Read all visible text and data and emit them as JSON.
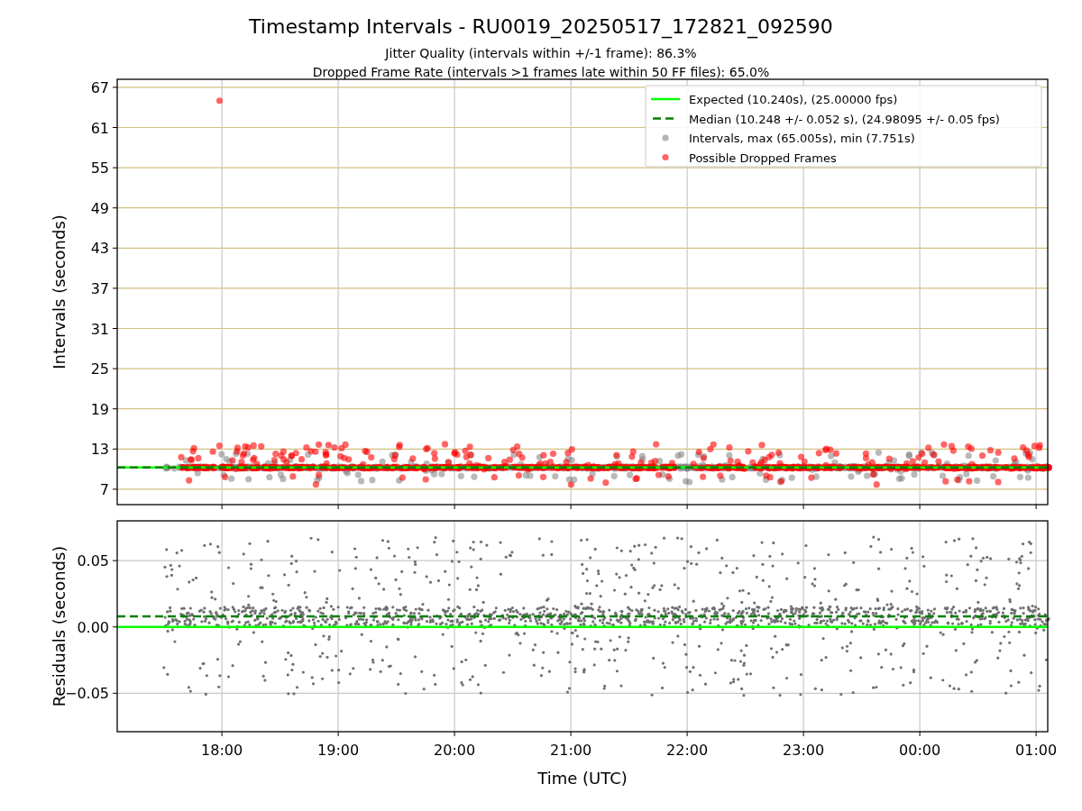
{
  "figure": {
    "title": "Timestamp Intervals - RU0019_20250517_172821_092590",
    "subtitles": [
      "Jitter Quality (intervals within +/-1 frame): 86.3%",
      "Dropped Frame Rate (intervals >1 frames late within 50 FF files): 65.0%"
    ]
  },
  "intervals_plot": {
    "chart_data": {
      "type": "scatter",
      "ylabel": "Intervals (seconds)",
      "ylim": [
        4.7,
        68.2
      ],
      "grid": true,
      "legend": true,
      "yticks": [
        {
          "value": 7,
          "label": "7"
        },
        {
          "value": 13,
          "label": "13"
        },
        {
          "value": 19,
          "label": "19"
        },
        {
          "value": 25,
          "label": "25"
        },
        {
          "value": 31,
          "label": "31"
        },
        {
          "value": 37,
          "label": "37"
        },
        {
          "value": 43,
          "label": "43"
        },
        {
          "value": 49,
          "label": "49"
        },
        {
          "value": 55,
          "label": "55"
        },
        {
          "value": 61,
          "label": "61"
        },
        {
          "value": 67,
          "label": "67"
        }
      ],
      "ref_lines": [
        {
          "axis": "y",
          "value": 10.24,
          "label": "Expected (10.240s), (25.00000 fps)",
          "color": "#00ff00"
        },
        {
          "axis": "y",
          "value": 10.248,
          "label": "Median (10.248 +/- 0.052 s), (24.98095 +/- 0.05 fps)",
          "color": "#008000"
        }
      ],
      "series": [
        {
          "name": "Intervals, max (65.005s), min (7.751s)",
          "color": "#808080"
        },
        {
          "name": "Possible Dropped Frames",
          "color": "#ff0000"
        }
      ]
    }
  },
  "residuals_plot": {
    "chart_data": {
      "type": "scatter",
      "xlabel": "Time (UTC)",
      "ylabel": "Residuals (seconds)",
      "xlim": [
        "2025-05-17T17:06",
        "2025-05-18T01:06"
      ],
      "ylim": [
        -0.079,
        0.08
      ],
      "grid": true,
      "xticks": [
        {
          "value": "2025-05-17T18:00",
          "label": "18:00"
        },
        {
          "value": "2025-05-17T19:00",
          "label": "19:00"
        },
        {
          "value": "2025-05-17T20:00",
          "label": "20:00"
        },
        {
          "value": "2025-05-17T21:00",
          "label": "21:00"
        },
        {
          "value": "2025-05-17T22:00",
          "label": "22:00"
        },
        {
          "value": "2025-05-17T23:00",
          "label": "23:00"
        },
        {
          "value": "2025-05-18T00:00",
          "label": "00:00"
        },
        {
          "value": "2025-05-18T01:00",
          "label": "01:00"
        }
      ],
      "yticks": [
        {
          "value": 0.05,
          "label": "0.05"
        },
        {
          "value": 0,
          "label": "0.00"
        },
        {
          "value": -0.05,
          "label": "−0.05"
        }
      ],
      "ref_lines": [
        {
          "axis": "y",
          "value": 0,
          "color": "#00ff00"
        },
        {
          "axis": "y",
          "value": 0.008,
          "color": "#008000"
        }
      ]
    }
  }
}
